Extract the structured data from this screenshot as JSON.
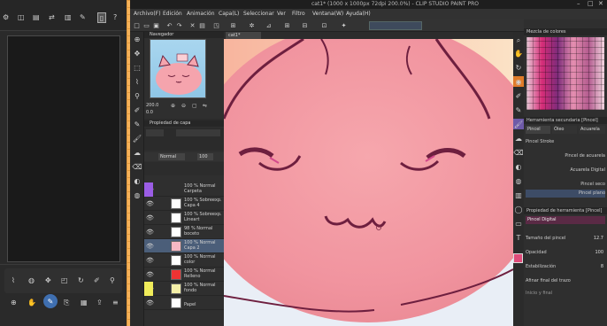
{
  "title_bar": {
    "text": "cat1* (1000 x 1000px 72dpi 200.0%) - CLIP STUDIO PAINT PRO"
  },
  "menu": [
    "Archivo(F)",
    "Edición",
    "Animación",
    "Capa(L)",
    "Seleccionar",
    "Ver",
    "Filtro",
    "Ventana(W)",
    "Ayuda(H)"
  ],
  "document_tab": "cat1*",
  "navigator": {
    "tab_label": "Navegador",
    "zoom": "200.0",
    "rotation": "0.0"
  },
  "layer_panel": {
    "header": "Propiedad de capa",
    "toolbar_label": "Normal",
    "opacity": "100",
    "layers": [
      {
        "line1": "100 % Normal",
        "line2": "Carpeta",
        "selected": false
      },
      {
        "line1": "100 % Sobreexp.",
        "line2": "Capa 4",
        "selected": false
      },
      {
        "line1": "100 % Sobreexp.",
        "line2": "Lineart",
        "selected": false
      },
      {
        "line1": "98 % Normal",
        "line2": "boceto",
        "selected": false
      },
      {
        "line1": "100 % Normal",
        "line2": "Capa 2",
        "selected": true
      },
      {
        "line1": "100 % Normal",
        "line2": "color",
        "selected": false
      },
      {
        "line1": "100 % Normal",
        "line2": "Relleno",
        "selected": false
      },
      {
        "line1": "100 % Normal",
        "line2": "fondo",
        "selected": false
      },
      {
        "line1": "",
        "line2": "Papel",
        "selected": false
      }
    ]
  },
  "right_panel": {
    "palette_title": "Mezcla de colores",
    "subtool_title": "Herramienta secundaria [Pincel]",
    "subtool_tabs": [
      "Pincel",
      "Óleo",
      "Acuarela"
    ],
    "brushes": [
      "Pincel Stroke",
      "Pincel de acuarela",
      "Acuarela Digital",
      "Pincel seco",
      "Pincel plano"
    ],
    "tool_props_title": "Propiedad de herramienta [Pincel]",
    "tool_props_selected": "Pincel Digital",
    "props": [
      {
        "label": "Tamaño del pincel",
        "value": "12.7"
      },
      {
        "label": "Opacidad",
        "value": "100"
      },
      {
        "label": "Estabilización",
        "value": "8"
      },
      {
        "label": "Afinar final del trazo",
        "value": ""
      },
      {
        "label": "Inicio y final",
        "value": ""
      }
    ],
    "accent_color": "#e04b7a"
  },
  "left_panel": {
    "top_icons": [
      "gear-icon",
      "layers-icon",
      "doc-icon",
      "swap-icon",
      "bar-icon",
      "brush-icon",
      "phone-icon",
      "help-icon"
    ],
    "bottom_icons_row1": [
      "lasso-icon",
      "fill-icon",
      "move-icon",
      "transform-icon",
      "rotate-icon",
      "pen-icon",
      "eyedrop-icon"
    ],
    "bottom_icons_row2": [
      "zoom-icon",
      "hand-icon",
      "brush-active-icon",
      "clip-icon",
      "layer-icon",
      "export-icon",
      "menu-icon"
    ]
  }
}
